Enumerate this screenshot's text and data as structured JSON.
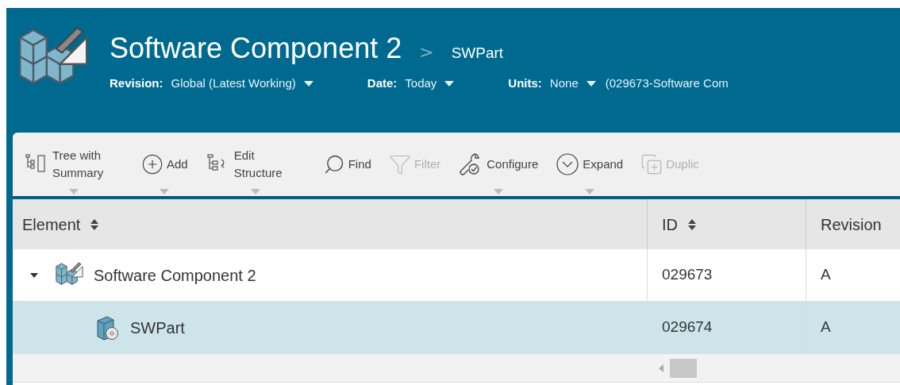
{
  "header": {
    "title": "Software Component 2",
    "breadcrumb_separator": ">",
    "breadcrumb": "SWPart",
    "filters": [
      {
        "label": "Revision:",
        "value": "Global (Latest Working)"
      },
      {
        "label": "Date:",
        "value": "Today"
      },
      {
        "label": "Units:",
        "value": "None"
      }
    ],
    "context": "(029673-Software Com"
  },
  "toolbar": [
    {
      "kind": "tree",
      "label": "Tree with Summary",
      "dropdown": true,
      "disabled": false
    },
    {
      "kind": "add",
      "label": "Add",
      "dropdown": true,
      "disabled": false
    },
    {
      "kind": "edit",
      "label": "Edit Structure",
      "dropdown": true,
      "disabled": false
    },
    {
      "kind": "find",
      "label": "Find",
      "dropdown": false,
      "disabled": false
    },
    {
      "kind": "filter",
      "label": "Filter",
      "dropdown": false,
      "disabled": true
    },
    {
      "kind": "configure",
      "label": "Configure",
      "dropdown": true,
      "disabled": false
    },
    {
      "kind": "expand",
      "label": "Expand",
      "dropdown": true,
      "disabled": false
    },
    {
      "kind": "duplicate",
      "label": "Duplic",
      "dropdown": false,
      "disabled": true
    }
  ],
  "table": {
    "columns": [
      {
        "label": "Element",
        "sortable": true
      },
      {
        "label": "ID",
        "sortable": true
      },
      {
        "label": "Revision",
        "sortable": false
      }
    ],
    "rows": [
      {
        "kind": "component",
        "element": "Software Component 2",
        "id": "029673",
        "revision": "A",
        "expanded": true,
        "selected": false,
        "children": [
          {
            "kind": "part",
            "element": "SWPart",
            "id": "029674",
            "revision": "A",
            "selected": true
          }
        ]
      }
    ]
  }
}
